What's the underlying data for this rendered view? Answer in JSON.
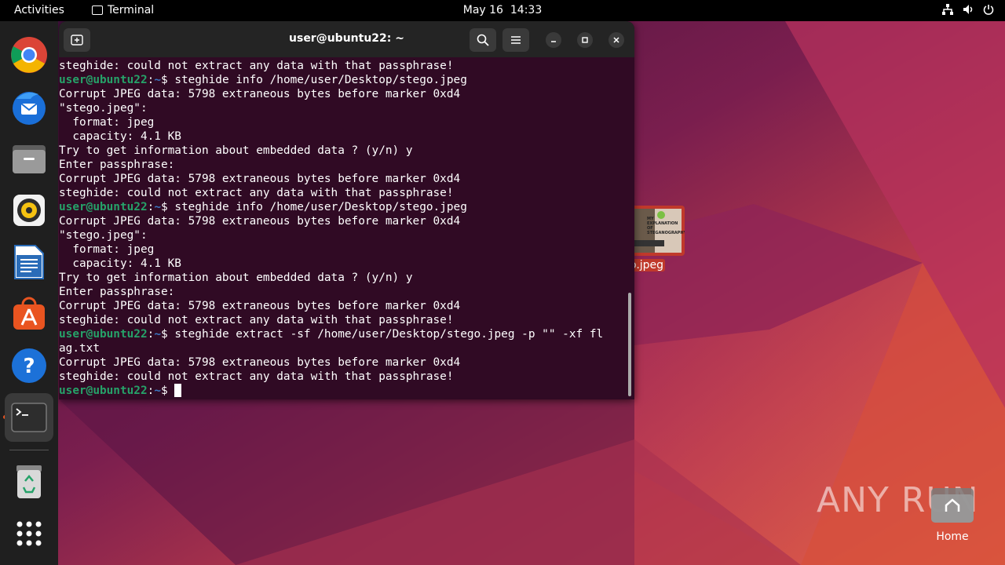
{
  "topbar": {
    "activities": "Activities",
    "app_name": "Terminal",
    "date": "May 16",
    "time": "14:33",
    "tray_icons": [
      "network-icon",
      "volume-icon",
      "power-icon"
    ]
  },
  "dock": {
    "items": [
      {
        "name": "chrome",
        "icon": "chrome-icon"
      },
      {
        "name": "thunderbird",
        "icon": "thunderbird-icon"
      },
      {
        "name": "files",
        "icon": "files-icon"
      },
      {
        "name": "rhythmbox",
        "icon": "rhythmbox-icon"
      },
      {
        "name": "libreoffice-writer",
        "icon": "writer-icon"
      },
      {
        "name": "app-center",
        "icon": "app-center-icon"
      },
      {
        "name": "help",
        "icon": "help-icon"
      },
      {
        "name": "terminal",
        "icon": "terminal-icon",
        "running": true
      },
      {
        "name": "trash",
        "icon": "trash-icon"
      },
      {
        "name": "show-apps",
        "icon": "apps-grid-icon"
      }
    ]
  },
  "terminal": {
    "title": "user@ubuntu22: ~",
    "prompt_user": "user@ubuntu22",
    "prompt_path": "~",
    "lines": [
      {
        "type": "out",
        "text": "steghide: could not extract any data with that passphrase!"
      },
      {
        "type": "cmd",
        "text": " steghide info /home/user/Desktop/stego.jpeg"
      },
      {
        "type": "out",
        "text": "Corrupt JPEG data: 5798 extraneous bytes before marker 0xd4"
      },
      {
        "type": "out",
        "text": "\"stego.jpeg\":"
      },
      {
        "type": "out",
        "text": "  format: jpeg"
      },
      {
        "type": "out",
        "text": "  capacity: 4.1 KB"
      },
      {
        "type": "out",
        "text": "Try to get information about embedded data ? (y/n) y"
      },
      {
        "type": "out",
        "text": "Enter passphrase:"
      },
      {
        "type": "out",
        "text": "Corrupt JPEG data: 5798 extraneous bytes before marker 0xd4"
      },
      {
        "type": "out",
        "text": "steghide: could not extract any data with that passphrase!"
      },
      {
        "type": "cmd",
        "text": " steghide info /home/user/Desktop/stego.jpeg"
      },
      {
        "type": "out",
        "text": "Corrupt JPEG data: 5798 extraneous bytes before marker 0xd4"
      },
      {
        "type": "out",
        "text": "\"stego.jpeg\":"
      },
      {
        "type": "out",
        "text": "  format: jpeg"
      },
      {
        "type": "out",
        "text": "  capacity: 4.1 KB"
      },
      {
        "type": "out",
        "text": "Try to get information about embedded data ? (y/n) y"
      },
      {
        "type": "out",
        "text": "Enter passphrase:"
      },
      {
        "type": "out",
        "text": "Corrupt JPEG data: 5798 extraneous bytes before marker 0xd4"
      },
      {
        "type": "out",
        "text": "steghide: could not extract any data with that passphrase!"
      },
      {
        "type": "cmd",
        "text": " steghide extract -sf /home/user/Desktop/stego.jpeg -p \"\" -xf fl"
      },
      {
        "type": "out",
        "text": "ag.txt"
      },
      {
        "type": "out",
        "text": "Corrupt JPEG data: 5798 extraneous bytes before marker 0xd4"
      },
      {
        "type": "out",
        "text": "steghide: could not extract any data with that passphrase!"
      },
      {
        "type": "cmd",
        "text": " ",
        "cursor": true
      }
    ]
  },
  "desktop": {
    "file_label": "o.jpeg",
    "thumb_text": "MY EXPLANATION OF STEGANOGRAPHY",
    "home_label": "Home",
    "watermark": "ANY RUN"
  },
  "colors": {
    "terminal_bg": "#300a24",
    "prompt_user": "#26a269",
    "prompt_path": "#3b78c4",
    "accent": "#e95420"
  }
}
